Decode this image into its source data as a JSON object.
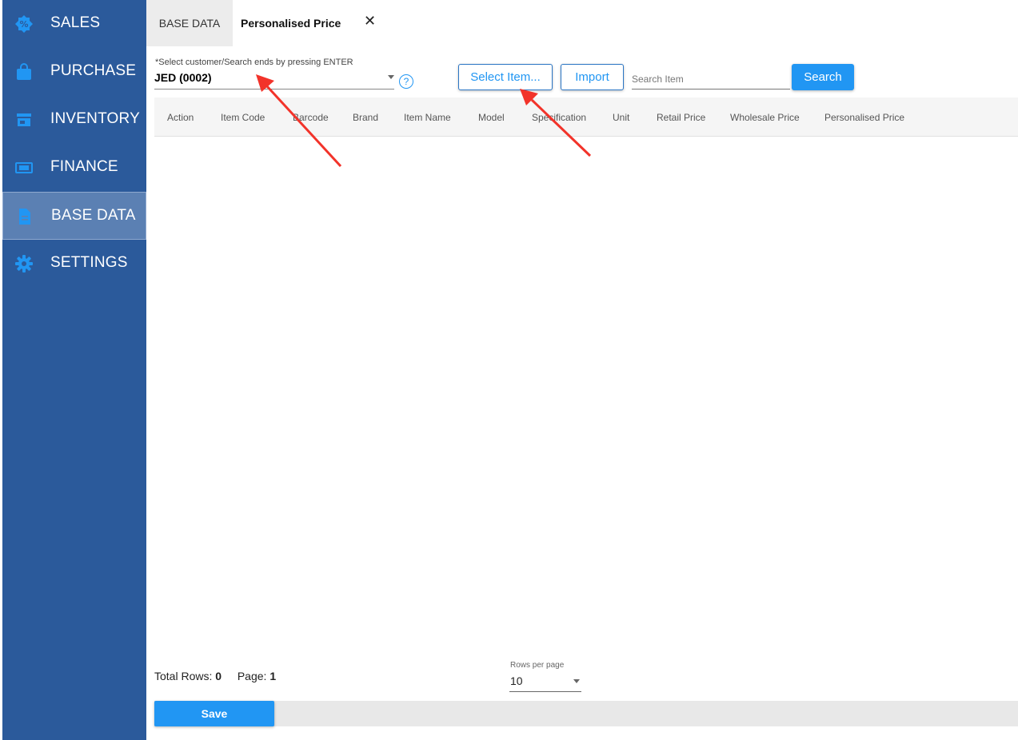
{
  "sidebar": {
    "items": [
      {
        "label": "SALES",
        "icon": "sales-badge-icon"
      },
      {
        "label": "PURCHASE",
        "icon": "shopping-bag-icon"
      },
      {
        "label": "INVENTORY",
        "icon": "store-icon"
      },
      {
        "label": "FINANCE",
        "icon": "money-icon"
      },
      {
        "label": "BASE DATA",
        "icon": "document-icon",
        "active": true
      },
      {
        "label": "SETTINGS",
        "icon": "gear-icon"
      }
    ]
  },
  "tabs": {
    "base": "BASE DATA",
    "current": "Personalised Price",
    "close": "✕"
  },
  "toolbar": {
    "customer_label": "*Select customer/Search ends by pressing ENTER",
    "customer_value": "JED (0002)",
    "help": "?",
    "select_item": "Select Item...",
    "import": "Import",
    "search_placeholder": "Search Item",
    "search": "Search"
  },
  "table": {
    "columns": [
      "Action",
      "Item Code",
      "Barcode",
      "Brand",
      "Item Name",
      "Model",
      "Specification",
      "Unit",
      "Retail Price",
      "Wholesale Price",
      "Personalised Price"
    ]
  },
  "footer": {
    "total_rows_label": "Total Rows:",
    "total_rows": "0",
    "page_label": "Page:",
    "page": "1",
    "rows_per_page_label": "Rows per page",
    "rows_per_page": "10",
    "save": "Save"
  },
  "colors": {
    "sidebar": "#2b5a9b",
    "sidebar_active": "#5b80b3",
    "accent": "#2196f3",
    "annotation": "#f2332a"
  }
}
